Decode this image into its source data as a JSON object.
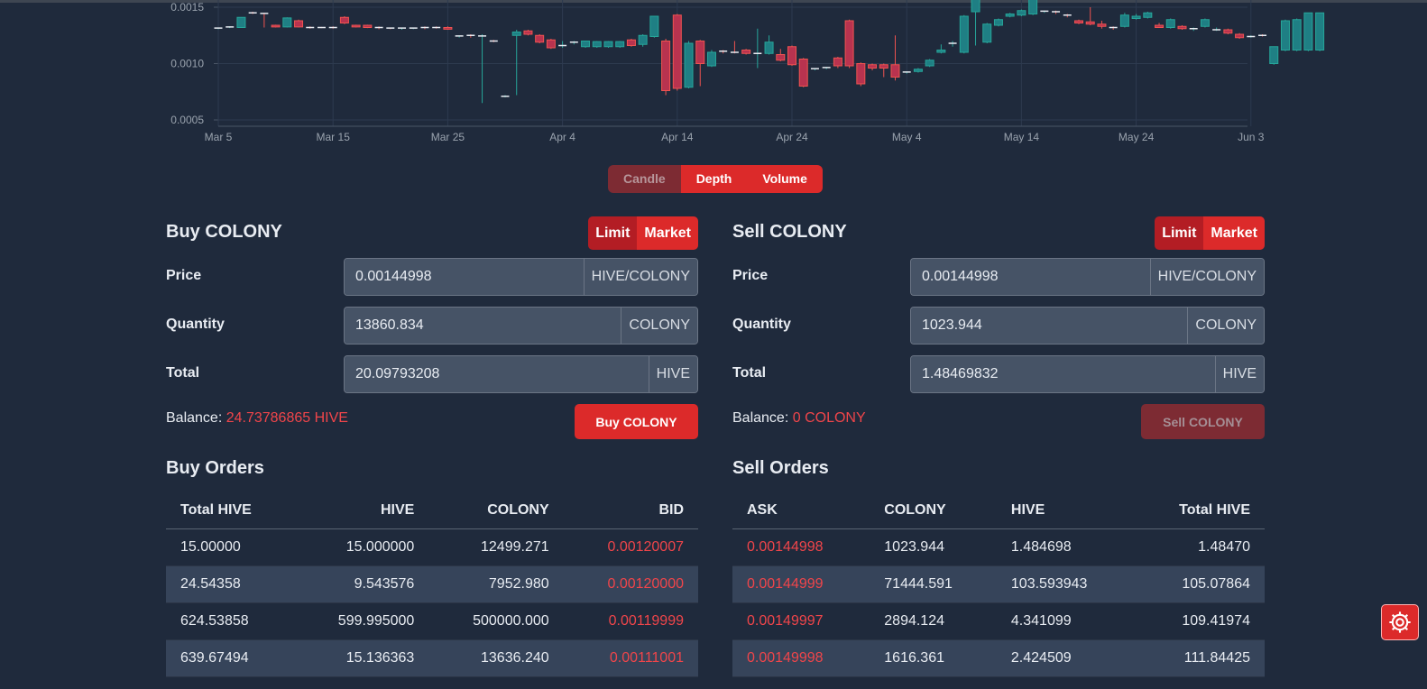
{
  "chart_data": {
    "type": "candlestick",
    "x_ticks": [
      "Mar 5",
      "Mar 15",
      "Mar 25",
      "Apr 4",
      "Apr 14",
      "Apr 24",
      "May 4",
      "May 14",
      "May 24",
      "Jun 3"
    ],
    "y_ticks": [
      "0.0015",
      "0.0010",
      "0.0005"
    ],
    "ylim": [
      0.00044,
      0.0016
    ],
    "grid": true,
    "up_color": "#26a69a",
    "down_color": "#ef5350",
    "candles": [
      {
        "day": 0,
        "o": 0.00131,
        "h": 0.00132,
        "l": 0.001305,
        "c": 0.001315
      },
      {
        "day": 1,
        "o": 0.00132,
        "h": 0.00133,
        "l": 0.001315,
        "c": 0.001325
      },
      {
        "day": 2,
        "o": 0.00132,
        "h": 0.00141,
        "l": 0.00132,
        "c": 0.00141
      },
      {
        "day": 3,
        "o": 0.00145,
        "h": 0.00146,
        "l": 0.00144,
        "c": 0.001445
      },
      {
        "day": 4,
        "o": 0.001445,
        "h": 0.00145,
        "l": 0.00132,
        "c": 0.00144
      },
      {
        "day": 5,
        "o": 0.00134,
        "h": 0.001345,
        "l": 0.00132,
        "c": 0.001325
      },
      {
        "day": 6,
        "o": 0.001325,
        "h": 0.00141,
        "l": 0.00132,
        "c": 0.001405
      },
      {
        "day": 7,
        "o": 0.00138,
        "h": 0.00139,
        "l": 0.00132,
        "c": 0.001325
      },
      {
        "day": 8,
        "o": 0.00132,
        "h": 0.00133,
        "l": 0.00131,
        "c": 0.001315
      },
      {
        "day": 9,
        "o": 0.00132,
        "h": 0.001325,
        "l": 0.001315,
        "c": 0.001318
      },
      {
        "day": 10,
        "o": 0.00132,
        "h": 0.00133,
        "l": 0.00131,
        "c": 0.001315
      },
      {
        "day": 11,
        "o": 0.00141,
        "h": 0.00142,
        "l": 0.00135,
        "c": 0.00136
      },
      {
        "day": 12,
        "o": 0.00134,
        "h": 0.001345,
        "l": 0.00132,
        "c": 0.001325
      },
      {
        "day": 13,
        "o": 0.00134,
        "h": 0.001345,
        "l": 0.001315,
        "c": 0.00132
      },
      {
        "day": 14,
        "o": 0.00132,
        "h": 0.00133,
        "l": 0.001305,
        "c": 0.00131
      },
      {
        "day": 15,
        "o": 0.001315,
        "h": 0.00132,
        "l": 0.001305,
        "c": 0.00131
      },
      {
        "day": 16,
        "o": 0.00131,
        "h": 0.00132,
        "l": 0.0013,
        "c": 0.001315
      },
      {
        "day": 17,
        "o": 0.00131,
        "h": 0.00132,
        "l": 0.001305,
        "c": 0.001315
      },
      {
        "day": 18,
        "o": 0.00132,
        "h": 0.00133,
        "l": 0.001305,
        "c": 0.00131
      },
      {
        "day": 19,
        "o": 0.00132,
        "h": 0.00133,
        "l": 0.00131,
        "c": 0.001318
      },
      {
        "day": 20,
        "o": 0.00132,
        "h": 0.00133,
        "l": 0.0013,
        "c": 0.001305
      },
      {
        "day": 21,
        "o": 0.00124,
        "h": 0.00125,
        "l": 0.00123,
        "c": 0.001245
      },
      {
        "day": 22,
        "o": 0.00125,
        "h": 0.00126,
        "l": 0.00123,
        "c": 0.00124
      },
      {
        "day": 23,
        "o": 0.001245,
        "h": 0.00126,
        "l": 0.00065,
        "c": 0.001245
      },
      {
        "day": 24,
        "o": 0.0012,
        "h": 0.00121,
        "l": 0.00119,
        "c": 0.001195
      },
      {
        "day": 25,
        "o": 0.00071,
        "h": 0.00072,
        "l": 0.0007,
        "c": 0.00071
      },
      {
        "day": 26,
        "o": 0.00125,
        "h": 0.0013,
        "l": 0.00072,
        "c": 0.00128
      },
      {
        "day": 27,
        "o": 0.00129,
        "h": 0.0013,
        "l": 0.00125,
        "c": 0.00126
      },
      {
        "day": 28,
        "o": 0.00125,
        "h": 0.00126,
        "l": 0.00118,
        "c": 0.00119
      },
      {
        "day": 29,
        "o": 0.00121,
        "h": 0.00122,
        "l": 0.00113,
        "c": 0.00114
      },
      {
        "day": 30,
        "o": 0.00115,
        "h": 0.0012,
        "l": 0.00114,
        "c": 0.00116
      },
      {
        "day": 31,
        "o": 0.00118,
        "h": 0.0012,
        "l": 0.00117,
        "c": 0.00119
      },
      {
        "day": 32,
        "o": 0.00115,
        "h": 0.0012,
        "l": 0.00114,
        "c": 0.0012
      },
      {
        "day": 33,
        "o": 0.00115,
        "h": 0.0012,
        "l": 0.00114,
        "c": 0.001195
      },
      {
        "day": 34,
        "o": 0.00115,
        "h": 0.0012,
        "l": 0.00114,
        "c": 0.001195
      },
      {
        "day": 35,
        "o": 0.00115,
        "h": 0.0012,
        "l": 0.00114,
        "c": 0.001195
      },
      {
        "day": 36,
        "o": 0.00121,
        "h": 0.00122,
        "l": 0.00115,
        "c": 0.00116
      },
      {
        "day": 37,
        "o": 0.00117,
        "h": 0.00126,
        "l": 0.00115,
        "c": 0.00125
      },
      {
        "day": 38,
        "o": 0.00124,
        "h": 0.00142,
        "l": 0.00123,
        "c": 0.00142
      },
      {
        "day": 39,
        "o": 0.0012,
        "h": 0.00122,
        "l": 0.00072,
        "c": 0.00076
      },
      {
        "day": 40,
        "o": 0.00143,
        "h": 0.00144,
        "l": 0.00076,
        "c": 0.00078
      },
      {
        "day": 41,
        "o": 0.00079,
        "h": 0.0012,
        "l": 0.00078,
        "c": 0.00118
      },
      {
        "day": 42,
        "o": 0.0012,
        "h": 0.00121,
        "l": 0.0008,
        "c": 0.001
      },
      {
        "day": 43,
        "o": 0.00098,
        "h": 0.00112,
        "l": 0.00097,
        "c": 0.0011
      },
      {
        "day": 44,
        "o": 0.00111,
        "h": 0.00112,
        "l": 0.00109,
        "c": 0.0011
      },
      {
        "day": 45,
        "o": 0.0011,
        "h": 0.0012,
        "l": 0.00109,
        "c": 0.001095
      },
      {
        "day": 46,
        "o": 0.00112,
        "h": 0.00113,
        "l": 0.00108,
        "c": 0.00109
      },
      {
        "day": 47,
        "o": 0.00108,
        "h": 0.00131,
        "l": 0.00096,
        "c": 0.00109
      },
      {
        "day": 48,
        "o": 0.00109,
        "h": 0.00125,
        "l": 0.00108,
        "c": 0.00119
      },
      {
        "day": 49,
        "o": 0.00108,
        "h": 0.00113,
        "l": 0.00102,
        "c": 0.00103
      },
      {
        "day": 50,
        "o": 0.00115,
        "h": 0.00116,
        "l": 0.00098,
        "c": 0.00099
      },
      {
        "day": 51,
        "o": 0.00104,
        "h": 0.00105,
        "l": 0.00079,
        "c": 0.0008
      },
      {
        "day": 52,
        "o": 0.00095,
        "h": 0.00096,
        "l": 0.00094,
        "c": 0.000955
      },
      {
        "day": 53,
        "o": 0.00096,
        "h": 0.00097,
        "l": 0.00095,
        "c": 0.000965
      },
      {
        "day": 54,
        "o": 0.00105,
        "h": 0.00106,
        "l": 0.00096,
        "c": 0.00098
      },
      {
        "day": 55,
        "o": 0.00138,
        "h": 0.00139,
        "l": 0.00096,
        "c": 0.00098
      },
      {
        "day": 56,
        "o": 0.001,
        "h": 0.00101,
        "l": 0.0008,
        "c": 0.00082
      },
      {
        "day": 57,
        "o": 0.00099,
        "h": 0.001,
        "l": 0.00094,
        "c": 0.00096
      },
      {
        "day": 58,
        "o": 0.00099,
        "h": 0.001,
        "l": 0.00088,
        "c": 0.00096
      },
      {
        "day": 59,
        "o": 0.00099,
        "h": 0.00125,
        "l": 0.00085,
        "c": 0.00088
      },
      {
        "day": 60,
        "o": 0.00092,
        "h": 0.00093,
        "l": 0.00091,
        "c": 0.000925
      },
      {
        "day": 61,
        "o": 0.00093,
        "h": 0.00096,
        "l": 0.00092,
        "c": 0.00095
      },
      {
        "day": 62,
        "o": 0.00098,
        "h": 0.00104,
        "l": 0.00097,
        "c": 0.00103
      },
      {
        "day": 63,
        "o": 0.0011,
        "h": 0.00117,
        "l": 0.00109,
        "c": 0.00112
      },
      {
        "day": 64,
        "o": 0.00117,
        "h": 0.0012,
        "l": 0.00115,
        "c": 0.00118
      },
      {
        "day": 65,
        "o": 0.0011,
        "h": 0.00143,
        "l": 0.00109,
        "c": 0.00142
      },
      {
        "day": 66,
        "o": 0.00146,
        "h": 0.0016,
        "l": 0.00116,
        "c": 0.0016
      },
      {
        "day": 67,
        "o": 0.00119,
        "h": 0.00136,
        "l": 0.00118,
        "c": 0.00135
      },
      {
        "day": 68,
        "o": 0.00134,
        "h": 0.0014,
        "l": 0.00133,
        "c": 0.00139
      },
      {
        "day": 69,
        "o": 0.00142,
        "h": 0.00145,
        "l": 0.00141,
        "c": 0.00144
      },
      {
        "day": 70,
        "o": 0.00143,
        "h": 0.00148,
        "l": 0.00142,
        "c": 0.00147
      },
      {
        "day": 71,
        "o": 0.00144,
        "h": 0.0016,
        "l": 0.00143,
        "c": 0.00158
      },
      {
        "day": 72,
        "o": 0.00146,
        "h": 0.00147,
        "l": 0.00145,
        "c": 0.001465
      },
      {
        "day": 73,
        "o": 0.00146,
        "h": 0.00147,
        "l": 0.00144,
        "c": 0.00145
      },
      {
        "day": 74,
        "o": 0.00143,
        "h": 0.00144,
        "l": 0.00141,
        "c": 0.00142
      },
      {
        "day": 75,
        "o": 0.00138,
        "h": 0.00139,
        "l": 0.00135,
        "c": 0.00136
      },
      {
        "day": 76,
        "o": 0.00137,
        "h": 0.0015,
        "l": 0.00134,
        "c": 0.00135
      },
      {
        "day": 77,
        "o": 0.00135,
        "h": 0.00138,
        "l": 0.00131,
        "c": 0.00133
      },
      {
        "day": 78,
        "o": 0.00132,
        "h": 0.00133,
        "l": 0.0013,
        "c": 0.00131
      },
      {
        "day": 79,
        "o": 0.00133,
        "h": 0.00145,
        "l": 0.00132,
        "c": 0.00143
      },
      {
        "day": 80,
        "o": 0.0014,
        "h": 0.00144,
        "l": 0.00139,
        "c": 0.00142
      },
      {
        "day": 81,
        "o": 0.00141,
        "h": 0.00146,
        "l": 0.0014,
        "c": 0.00145
      },
      {
        "day": 82,
        "o": 0.00134,
        "h": 0.00136,
        "l": 0.00132,
        "c": 0.00132
      },
      {
        "day": 83,
        "o": 0.00132,
        "h": 0.0014,
        "l": 0.00131,
        "c": 0.00139
      },
      {
        "day": 84,
        "o": 0.00133,
        "h": 0.00134,
        "l": 0.0013,
        "c": 0.00131
      },
      {
        "day": 85,
        "o": 0.0013,
        "h": 0.00132,
        "l": 0.00129,
        "c": 0.00131
      },
      {
        "day": 86,
        "o": 0.00133,
        "h": 0.0014,
        "l": 0.00132,
        "c": 0.00139
      },
      {
        "day": 87,
        "o": 0.0013,
        "h": 0.00132,
        "l": 0.00129,
        "c": 0.0013
      },
      {
        "day": 88,
        "o": 0.0013,
        "h": 0.00131,
        "l": 0.00126,
        "c": 0.00127
      },
      {
        "day": 89,
        "o": 0.00126,
        "h": 0.00127,
        "l": 0.00122,
        "c": 0.00123
      },
      {
        "day": 90,
        "o": 0.00124,
        "h": 0.00125,
        "l": 0.00123,
        "c": 0.00124
      },
      {
        "day": 91,
        "o": 0.00125,
        "h": 0.00126,
        "l": 0.00124,
        "c": 0.001245
      },
      {
        "day": 92,
        "o": 0.001,
        "h": 0.00115,
        "l": 0.00099,
        "c": 0.00115
      },
      {
        "day": 93,
        "o": 0.00112,
        "h": 0.00139,
        "l": 0.00111,
        "c": 0.00138
      },
      {
        "day": 94,
        "o": 0.00112,
        "h": 0.0014,
        "l": 0.00111,
        "c": 0.00139
      },
      {
        "day": 95,
        "o": 0.00112,
        "h": 0.00145,
        "l": 0.00111,
        "c": 0.00145
      },
      {
        "day": 96,
        "o": 0.00112,
        "h": 0.00145,
        "l": 0.00111,
        "c": 0.00145
      }
    ]
  },
  "chart_tabs": [
    "Candle",
    "Depth",
    "Volume"
  ],
  "buy": {
    "title": "Buy COLONY",
    "mode_limit": "Limit",
    "mode_market": "Market",
    "price_label": "Price",
    "price_value": "0.00144998",
    "price_unit": "HIVE/COLONY",
    "quantity_label": "Quantity",
    "quantity_value": "13860.834",
    "quantity_unit": "COLONY",
    "total_label": "Total",
    "total_value": "20.09793208",
    "total_unit": "HIVE",
    "balance_label": "Balance:",
    "balance_value": "24.73786865 HIVE",
    "action_label": "Buy COLONY"
  },
  "sell": {
    "title": "Sell COLONY",
    "mode_limit": "Limit",
    "mode_market": "Market",
    "price_label": "Price",
    "price_value": "0.00144998",
    "price_unit": "HIVE/COLONY",
    "quantity_label": "Quantity",
    "quantity_value": "1023.944",
    "quantity_unit": "COLONY",
    "total_label": "Total",
    "total_value": "1.48469832",
    "total_unit": "HIVE",
    "balance_label": "Balance:",
    "balance_value": "0 COLONY",
    "action_label": "Sell COLONY"
  },
  "buy_orders": {
    "title": "Buy Orders",
    "headers": [
      "Total HIVE",
      "HIVE",
      "COLONY",
      "BID"
    ],
    "rows": [
      [
        "15.00000",
        "15.000000",
        "12499.271",
        "0.00120007"
      ],
      [
        "24.54358",
        "9.543576",
        "7952.980",
        "0.00120000"
      ],
      [
        "624.53858",
        "599.995000",
        "500000.000",
        "0.00119999"
      ],
      [
        "639.67494",
        "15.136363",
        "13636.240",
        "0.00111001"
      ]
    ]
  },
  "sell_orders": {
    "title": "Sell Orders",
    "headers": [
      "ASK",
      "COLONY",
      "HIVE",
      "Total HIVE"
    ],
    "rows": [
      [
        "0.00144998",
        "1023.944",
        "1.484698",
        "1.48470"
      ],
      [
        "0.00144999",
        "71444.591",
        "103.593943",
        "105.07864"
      ],
      [
        "0.00149997",
        "2894.124",
        "4.341099",
        "109.41974"
      ],
      [
        "0.00149998",
        "1616.361",
        "2.424509",
        "111.84425"
      ]
    ]
  }
}
